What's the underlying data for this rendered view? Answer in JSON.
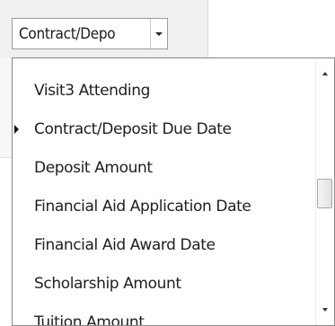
{
  "combo": {
    "value": "Contract/Depo"
  },
  "dropdown": {
    "items": [
      {
        "label": "Visit3 Attending",
        "selected": false
      },
      {
        "label": "Contract/Deposit Due Date",
        "selected": true
      },
      {
        "label": "Deposit Amount",
        "selected": false
      },
      {
        "label": "Financial Aid Application Date",
        "selected": false
      },
      {
        "label": "Financial Aid Award Date",
        "selected": false
      },
      {
        "label": "Scholarship Amount",
        "selected": false
      },
      {
        "label": "Tuition Amount",
        "selected": false
      }
    ]
  },
  "icons": {
    "combo_arrow": "chevron-down-icon",
    "selected_marker": "caret-right-icon",
    "scroll_up": "scroll-up-arrow-icon",
    "scroll_down": "scroll-down-arrow-icon"
  }
}
